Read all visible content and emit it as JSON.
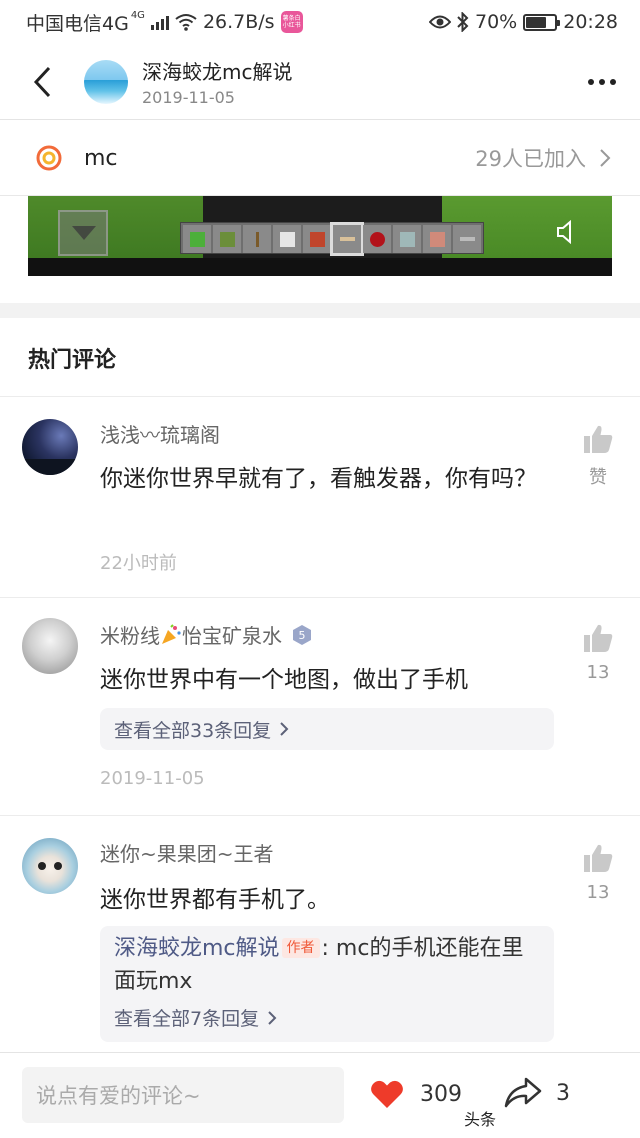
{
  "status_bar": {
    "carrier": "中国电信4G",
    "network_sup": "4G",
    "speed": "26.7B/s",
    "battery": "70%",
    "battery_level": 0.7,
    "time": "20:28",
    "app_badge_text": "薯条白 小红书"
  },
  "header": {
    "author_name": "深海蛟龙mc解说",
    "date": "2019-11-05"
  },
  "topic": {
    "name": "mc",
    "joined": "29人已加入"
  },
  "comments_section": {
    "title": "热门评论"
  },
  "comments": [
    {
      "name": "浅浅〰琉璃阁",
      "text": "你迷你世界早就有了，看触发器，你有吗？",
      "time": "22小时前",
      "like_label": "赞"
    },
    {
      "name_part1": "米粉线",
      "name_part2": "怡宝矿泉水",
      "level": "5",
      "text": "迷你世界中有一个地图，做出了手机",
      "like_label": "13",
      "replies_link": "查看全部33条回复",
      "time": "2019-11-05"
    },
    {
      "name": "迷你~果果团~王者",
      "text": "迷你世界都有手机了。",
      "like_label": "13",
      "reply_author": "深海蛟龙mc解说",
      "reply_tag": "作者",
      "reply_text": ": mc的手机还能在里面玩mx",
      "replies_link": "查看全部7条回复"
    }
  ],
  "bottom_bar": {
    "input_placeholder": "说点有爱的评论~",
    "like_count": "309",
    "share_count": "3"
  },
  "watermark": "头条"
}
